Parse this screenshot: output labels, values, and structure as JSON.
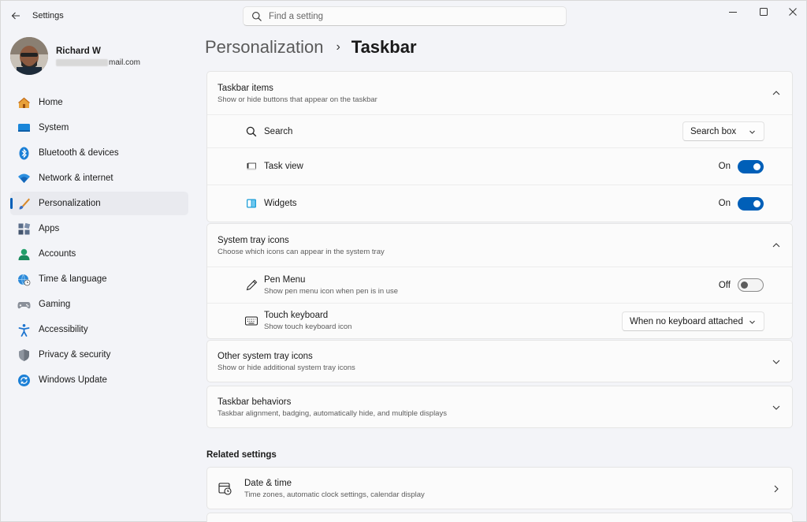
{
  "window": {
    "app_title": "Settings",
    "search_placeholder": "Find a setting",
    "controls": {
      "minimize": "—",
      "maximize": "□",
      "close": "✕"
    }
  },
  "profile": {
    "name": "Richard W",
    "email_visible": "mail.com"
  },
  "sidebar": {
    "items": [
      {
        "label": "Home",
        "icon": "home-icon"
      },
      {
        "label": "System",
        "icon": "system-icon"
      },
      {
        "label": "Bluetooth & devices",
        "icon": "bluetooth-icon"
      },
      {
        "label": "Network & internet",
        "icon": "wifi-icon"
      },
      {
        "label": "Personalization",
        "icon": "brush-icon",
        "active": true
      },
      {
        "label": "Apps",
        "icon": "apps-icon"
      },
      {
        "label": "Accounts",
        "icon": "accounts-icon"
      },
      {
        "label": "Time & language",
        "icon": "globe-clock-icon"
      },
      {
        "label": "Gaming",
        "icon": "gamepad-icon"
      },
      {
        "label": "Accessibility",
        "icon": "accessibility-icon"
      },
      {
        "label": "Privacy & security",
        "icon": "shield-icon"
      },
      {
        "label": "Windows Update",
        "icon": "update-icon"
      }
    ]
  },
  "breadcrumb": {
    "parent": "Personalization",
    "separator": "›",
    "current": "Taskbar"
  },
  "taskbar_items": {
    "title": "Taskbar items",
    "subtitle": "Show or hide buttons that appear on the taskbar",
    "rows": {
      "search": {
        "label": "Search",
        "value": "Search box"
      },
      "task_view": {
        "label": "Task view",
        "state": "On"
      },
      "widgets": {
        "label": "Widgets",
        "state": "On"
      }
    }
  },
  "system_tray": {
    "title": "System tray icons",
    "subtitle": "Choose which icons can appear in the system tray",
    "rows": {
      "pen_menu": {
        "label": "Pen Menu",
        "sub": "Show pen menu icon when pen is in use",
        "state": "Off"
      },
      "touch_keyboard": {
        "label": "Touch keyboard",
        "sub": "Show touch keyboard icon",
        "value": "When no keyboard attached"
      }
    }
  },
  "other_tray": {
    "title": "Other system tray icons",
    "subtitle": "Show or hide additional system tray icons"
  },
  "behaviors": {
    "title": "Taskbar behaviors",
    "subtitle": "Taskbar alignment, badging, automatically hide, and multiple displays"
  },
  "related": {
    "heading": "Related settings",
    "date_time": {
      "title": "Date & time",
      "subtitle": "Time zones, automatic clock settings, calendar display"
    }
  },
  "colors": {
    "accent": "#005fb8",
    "window_bg": "#f3f4f8",
    "card_bg": "#fbfbfb"
  }
}
